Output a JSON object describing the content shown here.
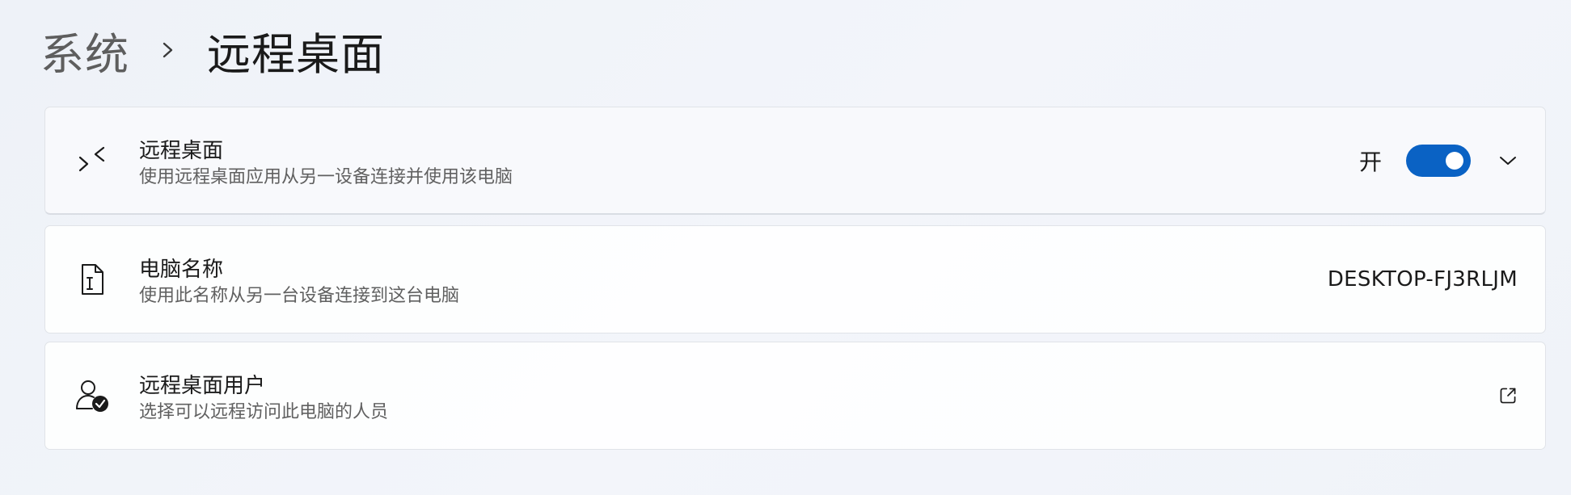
{
  "breadcrumb": {
    "parent": "系统",
    "current": "远程桌面"
  },
  "cards": [
    {
      "icon": "remote-desktop-icon",
      "title": "远程桌面",
      "description": "使用远程桌面应用从另一设备连接并使用该电脑",
      "toggle_label": "开",
      "toggle_state": "on"
    },
    {
      "icon": "pc-name-icon",
      "title": "电脑名称",
      "description": "使用此名称从另一台设备连接到这台电脑",
      "value": "DESKTOP-FJ3RLJM"
    },
    {
      "icon": "user-check-icon",
      "title": "远程桌面用户",
      "description": "选择可以远程访问此电脑的人员",
      "action_icon": "external-link-icon"
    }
  ],
  "colors": {
    "accent": "#0a62c4"
  }
}
